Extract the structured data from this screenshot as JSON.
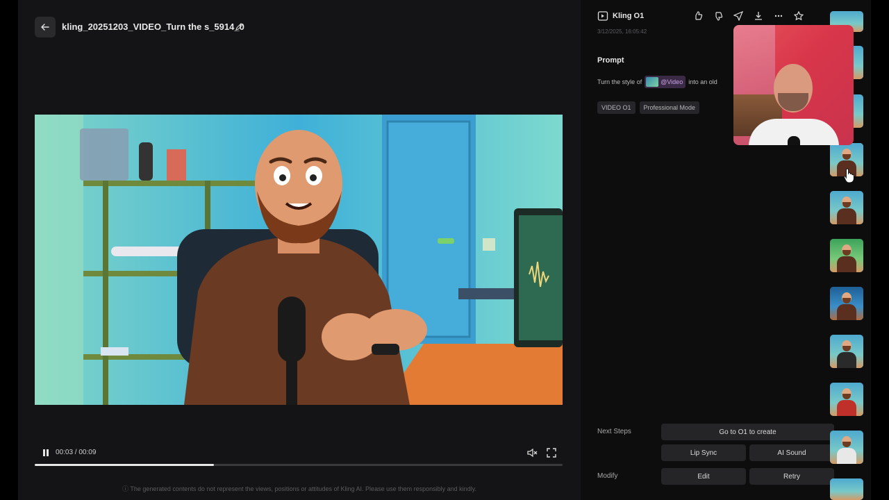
{
  "header": {
    "file_title": "kling_20251203_VIDEO_Turn the s_5914_0"
  },
  "player": {
    "timecode": "00:03 / 00:09",
    "progress": 0.34
  },
  "disclaimer": "ⓘ The generated contents do not represent the views, positions or attitudes of Kling AI. Please use them responsibly and kindly.",
  "panel": {
    "model": "Kling O1",
    "timestamp": "3/12/2025, 16:05:42",
    "prompt_label": "Prompt",
    "prompt_prefix": "Turn the style of",
    "prompt_chip": "@Video",
    "prompt_suffix": "into an old",
    "tags": [
      "VIDEO O1",
      "Professional Mode"
    ],
    "next_steps_label": "Next Steps",
    "modify_label": "Modify",
    "buttons": {
      "go_o1": "Go to O1 to create",
      "lip_sync": "Lip Sync",
      "ai_sound": "AI Sound",
      "edit": "Edit",
      "retry": "Retry"
    }
  },
  "icons": {
    "back": "arrow-left-icon",
    "edit": "pencil-icon",
    "like": "thumbs-up-icon",
    "dislike": "thumbs-down-icon",
    "share": "send-icon",
    "download": "download-icon",
    "more": "more-icon",
    "favorite": "star-icon",
    "play_pause": "pause-icon",
    "mute": "mute-icon",
    "fullscreen": "fullscreen-icon"
  },
  "colors": {
    "accent_chip": "#c9a3e6",
    "panel_bg": "#0d0d0e",
    "player_bg": "#141416"
  }
}
